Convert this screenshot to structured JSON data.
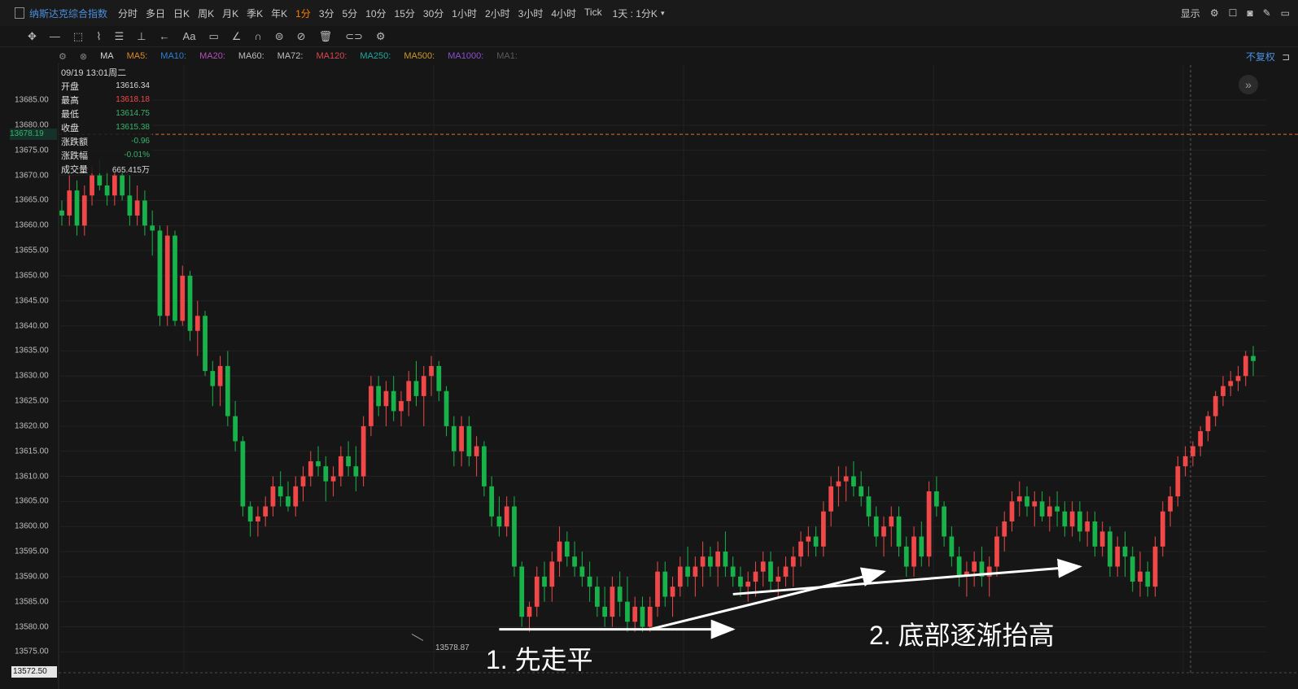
{
  "topbar": {
    "ticker": "纳斯达克综合指数",
    "periods": [
      "分时",
      "多日",
      "日K",
      "周K",
      "月K",
      "季K",
      "年K",
      "1分",
      "3分",
      "5分",
      "10分",
      "15分",
      "30分",
      "1小时",
      "2小时",
      "3小时",
      "4小时",
      "Tick"
    ],
    "active_period": "1分",
    "range_label": "1天 : 1分K",
    "display_label": "显示"
  },
  "indicator_bar": {
    "name": "MA",
    "items": [
      {
        "label": "MA5:",
        "color": "#d98a2b"
      },
      {
        "label": "MA10:",
        "color": "#2f7fd0"
      },
      {
        "label": "MA20:",
        "color": "#b24fb8"
      },
      {
        "label": "MA60:",
        "color": "#bdbdbd"
      },
      {
        "label": "MA72:",
        "color": "#bdbdbd"
      },
      {
        "label": "MA120:",
        "color": "#d9474f"
      },
      {
        "label": "MA250:",
        "color": "#1fa8a0"
      },
      {
        "label": "MA500:",
        "color": "#c99a2a"
      },
      {
        "label": "MA1000:",
        "color": "#8c4fd0"
      },
      {
        "label": "MA1:",
        "color": "#5b5b5b"
      }
    ],
    "adjust_label": "不复权"
  },
  "info_panel": {
    "datetime": "09/19 13:01周二",
    "rows": [
      {
        "label": "开盘",
        "value": "13616.34",
        "color": "#d8d8d8"
      },
      {
        "label": "最高",
        "value": "13618.18",
        "color": "#f04848"
      },
      {
        "label": "最低",
        "value": "13614.75",
        "color": "#38b36a"
      },
      {
        "label": "收盘",
        "value": "13615.38",
        "color": "#38b36a"
      },
      {
        "label": "涨跌额",
        "value": "-0.96",
        "color": "#38b36a"
      },
      {
        "label": "涨跌幅",
        "value": "-0.01%",
        "color": "#38b36a"
      },
      {
        "label": "成交量",
        "value": "665.415万",
        "color": "#d8d8d8"
      }
    ]
  },
  "annotations": {
    "flat": "1. 先走平",
    "higher_lows": "2. 底部逐渐抬高",
    "low_label": "13578.87"
  },
  "chart_data": {
    "type": "candlestick",
    "y_ticks": [
      13685.0,
      13680.0,
      13675.0,
      13670.0,
      13665.0,
      13660.0,
      13655.0,
      13650.0,
      13645.0,
      13640.0,
      13635.0,
      13630.0,
      13625.0,
      13620.0,
      13615.0,
      13610.0,
      13605.0,
      13600.0,
      13595.0,
      13590.0,
      13585.0,
      13580.0,
      13575.0
    ],
    "ylim": [
      13571.0,
      13692.0
    ],
    "current_price": "13678.19",
    "axis_min_label": "13572.50",
    "low_marker": 13578.87,
    "up_color": "#f04848",
    "down_color": "#17b24a",
    "candles": [
      [
        13663,
        13665,
        13660,
        13662
      ],
      [
        13662,
        13670,
        13660,
        13667
      ],
      [
        13667,
        13669,
        13658,
        13660
      ],
      [
        13660,
        13668,
        13658,
        13666
      ],
      [
        13666,
        13672,
        13664,
        13670
      ],
      [
        13670,
        13673,
        13667,
        13668
      ],
      [
        13668,
        13671,
        13664,
        13666
      ],
      [
        13666,
        13672,
        13664,
        13670
      ],
      [
        13670,
        13671,
        13665,
        13666
      ],
      [
        13666,
        13670,
        13660,
        13662
      ],
      [
        13662,
        13668,
        13660,
        13665
      ],
      [
        13665,
        13667,
        13658,
        13660
      ],
      [
        13660,
        13663,
        13654,
        13659
      ],
      [
        13659,
        13660,
        13640,
        13642
      ],
      [
        13642,
        13660,
        13640,
        13658
      ],
      [
        13658,
        13659,
        13640,
        13641
      ],
      [
        13641,
        13652,
        13640,
        13650
      ],
      [
        13650,
        13651,
        13637,
        13639
      ],
      [
        13639,
        13645,
        13634,
        13642
      ],
      [
        13642,
        13643,
        13630,
        13631
      ],
      [
        13631,
        13633,
        13624,
        13628
      ],
      [
        13628,
        13634,
        13624,
        13632
      ],
      [
        13632,
        13635,
        13620,
        13622
      ],
      [
        13622,
        13625,
        13615,
        13617
      ],
      [
        13617,
        13618,
        13602,
        13604
      ],
      [
        13604,
        13605,
        13598,
        13601
      ],
      [
        13601,
        13604,
        13598,
        13602
      ],
      [
        13602,
        13606,
        13600,
        13604
      ],
      [
        13604,
        13610,
        13602,
        13608
      ],
      [
        13608,
        13611,
        13604,
        13606
      ],
      [
        13606,
        13609,
        13603,
        13604
      ],
      [
        13604,
        13610,
        13602,
        13608
      ],
      [
        13608,
        13612,
        13605,
        13610
      ],
      [
        13610,
        13615,
        13608,
        13613
      ],
      [
        13613,
        13616,
        13610,
        13612
      ],
      [
        13612,
        13614,
        13605,
        13609
      ],
      [
        13609,
        13612,
        13606,
        13610
      ],
      [
        13610,
        13616,
        13608,
        13614
      ],
      [
        13614,
        13617,
        13610,
        13612
      ],
      [
        13612,
        13616,
        13607,
        13610
      ],
      [
        13610,
        13622,
        13608,
        13620
      ],
      [
        13620,
        13630,
        13618,
        13628
      ],
      [
        13628,
        13630,
        13622,
        13624
      ],
      [
        13624,
        13629,
        13620,
        13627
      ],
      [
        13627,
        13630,
        13621,
        13623
      ],
      [
        13623,
        13627,
        13620,
        13625
      ],
      [
        13625,
        13631,
        13622,
        13629
      ],
      [
        13629,
        13633,
        13624,
        13626
      ],
      [
        13626,
        13632,
        13620,
        13630
      ],
      [
        13630,
        13634,
        13626,
        13632
      ],
      [
        13632,
        13633,
        13625,
        13627
      ],
      [
        13627,
        13628,
        13618,
        13620
      ],
      [
        13620,
        13622,
        13612,
        13615
      ],
      [
        13615,
        13622,
        13612,
        13620
      ],
      [
        13620,
        13622,
        13612,
        13614
      ],
      [
        13614,
        13618,
        13610,
        13616
      ],
      [
        13616,
        13617,
        13606,
        13608
      ],
      [
        13608,
        13610,
        13600,
        13602
      ],
      [
        13602,
        13606,
        13598,
        13600
      ],
      [
        13600,
        13606,
        13598,
        13604
      ],
      [
        13604,
        13606,
        13590,
        13592
      ],
      [
        13592,
        13593,
        13580,
        13582
      ],
      [
        13582,
        13585,
        13579,
        13584
      ],
      [
        13584,
        13592,
        13582,
        13590
      ],
      [
        13590,
        13593,
        13585,
        13588
      ],
      [
        13588,
        13595,
        13585,
        13593
      ],
      [
        13593,
        13600,
        13590,
        13597
      ],
      [
        13597,
        13599,
        13592,
        13594
      ],
      [
        13594,
        13597,
        13590,
        13592
      ],
      [
        13592,
        13595,
        13588,
        13590
      ],
      [
        13590,
        13593,
        13585,
        13588
      ],
      [
        13588,
        13590,
        13582,
        13584
      ],
      [
        13584,
        13588,
        13580,
        13582
      ],
      [
        13582,
        13590,
        13580,
        13588
      ],
      [
        13588,
        13591,
        13582,
        13585
      ],
      [
        13585,
        13590,
        13579,
        13581
      ],
      [
        13581,
        13586,
        13579,
        13584
      ],
      [
        13584,
        13586,
        13579,
        13580
      ],
      [
        13580,
        13586,
        13579,
        13584
      ],
      [
        13584,
        13593,
        13582,
        13591
      ],
      [
        13591,
        13593,
        13584,
        13586
      ],
      [
        13586,
        13590,
        13582,
        13588
      ],
      [
        13588,
        13594,
        13586,
        13592
      ],
      [
        13592,
        13596,
        13588,
        13590
      ],
      [
        13590,
        13594,
        13586,
        13592
      ],
      [
        13592,
        13597,
        13588,
        13594
      ],
      [
        13594,
        13596,
        13590,
        13592
      ],
      [
        13592,
        13597,
        13588,
        13595
      ],
      [
        13595,
        13599,
        13590,
        13592
      ],
      [
        13592,
        13594,
        13588,
        13590
      ],
      [
        13590,
        13592,
        13586,
        13588
      ],
      [
        13588,
        13591,
        13585,
        13589
      ],
      [
        13589,
        13593,
        13586,
        13591
      ],
      [
        13591,
        13595,
        13588,
        13593
      ],
      [
        13593,
        13595,
        13587,
        13589
      ],
      [
        13589,
        13592,
        13586,
        13590
      ],
      [
        13590,
        13594,
        13588,
        13592
      ],
      [
        13592,
        13596,
        13588,
        13594
      ],
      [
        13594,
        13599,
        13592,
        13597
      ],
      [
        13597,
        13600,
        13594,
        13598
      ],
      [
        13598,
        13600,
        13594,
        13596
      ],
      [
        13596,
        13605,
        13594,
        13603
      ],
      [
        13603,
        13610,
        13600,
        13608
      ],
      [
        13608,
        13612,
        13604,
        13609
      ],
      [
        13609,
        13612,
        13605,
        13610
      ],
      [
        13610,
        13613,
        13606,
        13608
      ],
      [
        13608,
        13611,
        13604,
        13606
      ],
      [
        13606,
        13608,
        13600,
        13602
      ],
      [
        13602,
        13604,
        13596,
        13598
      ],
      [
        13598,
        13602,
        13594,
        13600
      ],
      [
        13600,
        13604,
        13596,
        13602
      ],
      [
        13602,
        13604,
        13594,
        13596
      ],
      [
        13596,
        13598,
        13590,
        13592
      ],
      [
        13592,
        13600,
        13590,
        13598
      ],
      [
        13598,
        13601,
        13592,
        13594
      ],
      [
        13594,
        13609,
        13592,
        13607
      ],
      [
        13607,
        13610,
        13602,
        13604
      ],
      [
        13604,
        13605,
        13596,
        13598
      ],
      [
        13598,
        13600,
        13592,
        13594
      ],
      [
        13594,
        13596,
        13588,
        13590
      ],
      [
        13590,
        13593,
        13586,
        13591
      ],
      [
        13591,
        13595,
        13588,
        13593
      ],
      [
        13593,
        13596,
        13588,
        13590
      ],
      [
        13590,
        13594,
        13586,
        13592
      ],
      [
        13592,
        13600,
        13590,
        13598
      ],
      [
        13598,
        13603,
        13595,
        13601
      ],
      [
        13601,
        13607,
        13599,
        13605
      ],
      [
        13605,
        13609,
        13602,
        13606
      ],
      [
        13606,
        13608,
        13602,
        13604
      ],
      [
        13604,
        13607,
        13600,
        13605
      ],
      [
        13605,
        13607,
        13601,
        13602
      ],
      [
        13602,
        13606,
        13599,
        13604
      ],
      [
        13604,
        13607,
        13600,
        13603
      ],
      [
        13603,
        13605,
        13598,
        13600
      ],
      [
        13600,
        13605,
        13598,
        13603
      ],
      [
        13603,
        13605,
        13597,
        13599
      ],
      [
        13599,
        13603,
        13596,
        13601
      ],
      [
        13601,
        13603,
        13594,
        13596
      ],
      [
        13596,
        13601,
        13594,
        13599
      ],
      [
        13599,
        13600,
        13590,
        13592
      ],
      [
        13592,
        13598,
        13590,
        13596
      ],
      [
        13596,
        13599,
        13590,
        13594
      ],
      [
        13594,
        13596,
        13587,
        13589
      ],
      [
        13589,
        13595,
        13586,
        13591
      ],
      [
        13591,
        13593,
        13586,
        13588
      ],
      [
        13588,
        13598,
        13586,
        13596
      ],
      [
        13596,
        13605,
        13594,
        13603
      ],
      [
        13603,
        13608,
        13600,
        13606
      ],
      [
        13606,
        13614,
        13604,
        13612
      ],
      [
        13612,
        13616,
        13610,
        13614
      ],
      [
        13614,
        13617,
        13612,
        13616
      ],
      [
        13616,
        13620,
        13614,
        13619
      ],
      [
        13619,
        13623,
        13617,
        13622
      ],
      [
        13622,
        13627,
        13620,
        13626
      ],
      [
        13626,
        13630,
        13624,
        13628
      ],
      [
        13628,
        13631,
        13626,
        13629
      ],
      [
        13629,
        13632,
        13627,
        13630
      ],
      [
        13630,
        13635,
        13628,
        13634
      ],
      [
        13634,
        13636,
        13630,
        13633
      ]
    ],
    "annotation_arrows": [
      {
        "label": "1. 先走平",
        "from": [
          58,
          13579.5
        ],
        "to": [
          89,
          13579.5
        ]
      },
      {
        "label": "2. 底部逐渐抬高",
        "from": [
          78,
          13579.5
        ],
        "to": [
          109,
          13591.0
        ]
      },
      {
        "label": "2. 底部逐渐抬高",
        "from": [
          89,
          13586.5
        ],
        "to": [
          135,
          13592.0
        ]
      }
    ]
  }
}
